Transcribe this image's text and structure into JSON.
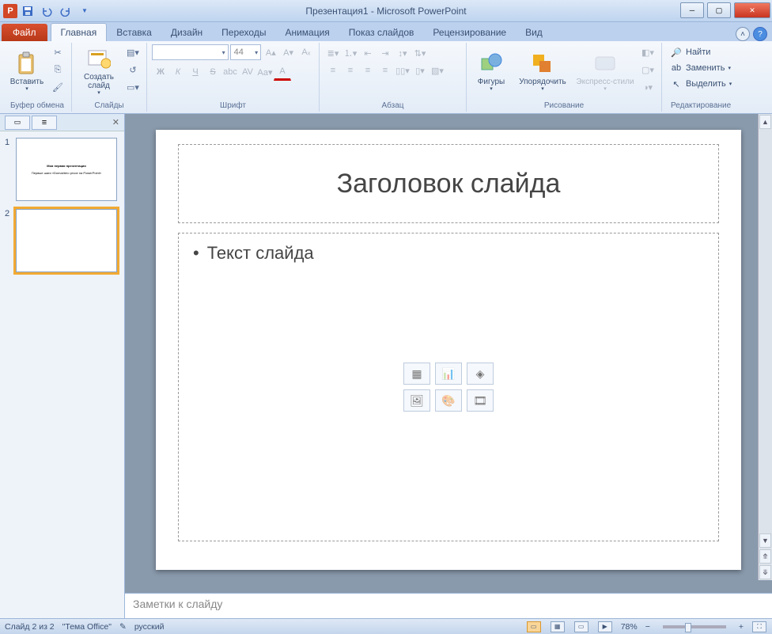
{
  "title": "Презентация1 - Microsoft PowerPoint",
  "file_tab": "Файл",
  "tabs": [
    "Главная",
    "Вставка",
    "Дизайн",
    "Переходы",
    "Анимация",
    "Показ слайдов",
    "Рецензирование",
    "Вид"
  ],
  "groups": {
    "clipboard": {
      "label": "Буфер обмена",
      "paste": "Вставить"
    },
    "slides": {
      "label": "Слайды",
      "new": "Создать слайд"
    },
    "font": {
      "label": "Шрифт",
      "size": "44"
    },
    "paragraph": {
      "label": "Абзац"
    },
    "drawing": {
      "label": "Рисование",
      "shapes": "Фигуры",
      "arrange": "Упорядочить",
      "styles": "Экспресс-стили"
    },
    "editing": {
      "label": "Редактирование",
      "find": "Найти",
      "replace": "Заменить",
      "select": "Выделить"
    }
  },
  "thumbs": [
    {
      "num": "1",
      "title": "Моя первая презентация",
      "sub": "Первые шаги «Domačtero prvoe na PowerPoint»"
    },
    {
      "num": "2",
      "title": "",
      "sub": ""
    }
  ],
  "slide": {
    "title": "Заголовок слайда",
    "body": "Текст слайда"
  },
  "notes_placeholder": "Заметки к слайду",
  "status": {
    "slide": "Слайд 2 из 2",
    "theme": "\"Тема Office\"",
    "lang": "русский",
    "zoom": "78%"
  }
}
